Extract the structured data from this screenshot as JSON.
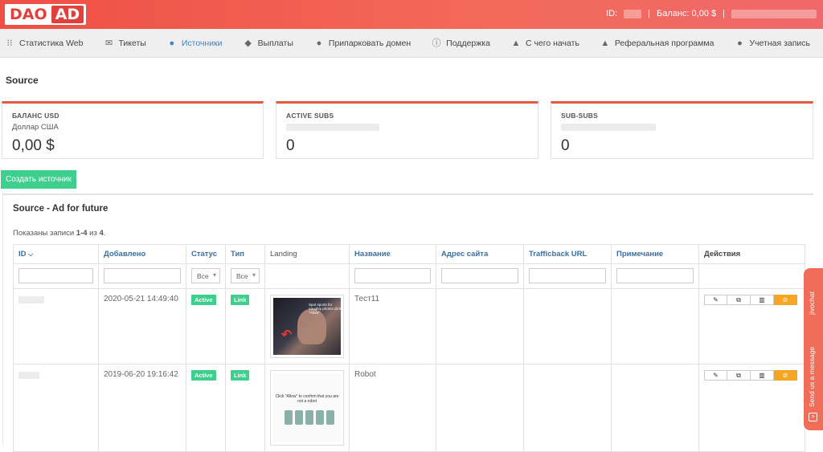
{
  "header": {
    "logo_left": "DAO",
    "logo_right": "AD",
    "id_label": "ID:",
    "balance": "Баланс: 0,00 $",
    "sep": "|"
  },
  "nav": {
    "items": [
      {
        "label": "Статистика Web",
        "icon": "grid-icon"
      },
      {
        "label": "Тикеты",
        "icon": "envelope-icon"
      },
      {
        "label": "Источники",
        "icon": "globe-icon"
      },
      {
        "label": "Выплаты",
        "icon": "piggy-bank-icon"
      },
      {
        "label": "Припарковать домен",
        "icon": "globe-icon"
      },
      {
        "label": "Поддержка",
        "icon": "info-icon"
      },
      {
        "label": "С чего начать",
        "icon": "road-icon"
      },
      {
        "label": "Реферальная программа",
        "icon": "road-icon"
      },
      {
        "label": "Учетная запись",
        "icon": "user-icon"
      }
    ]
  },
  "page": {
    "title": "Source"
  },
  "cards": [
    {
      "label": "БАЛАНС USD",
      "sub": "Доллар США",
      "value": "0,00 $"
    },
    {
      "label": "ACTIVE SUBS",
      "value": "0"
    },
    {
      "label": "SUB-SUBS",
      "value": "0"
    }
  ],
  "create_button": "Создать источник",
  "panel": {
    "title": "Source - Ad for future",
    "records_prefix": "Показаны записи ",
    "records_range": "1-4",
    "records_mid": " из ",
    "records_total": "4",
    "records_suffix": "."
  },
  "table": {
    "headers": {
      "id": "ID",
      "added": "Добавлено",
      "status": "Статус",
      "type": "Тип",
      "landing": "Landing",
      "name": "Название",
      "site": "Адрес сайта",
      "traffic": "Trafficback URL",
      "note": "Примечание",
      "actions": "Действия"
    },
    "filter_all": "Все",
    "rows": [
      {
        "added": "2020-05-21 14:49:40",
        "status": "Active",
        "type": "Link",
        "name": "Тест11",
        "landing_caption": "Spot sports\nfor naughty photos\nclick \"Allow\""
      },
      {
        "added": "2019-06-20 19:16:42",
        "status": "Active",
        "type": "Link",
        "name": "Robot",
        "landing_caption": "Click \"Allow\"\nto confirm that you are not a robot"
      }
    ],
    "action_icons": [
      "pencil-icon",
      "copy-icon",
      "stats-icon",
      "link-icon"
    ]
  },
  "chat": {
    "brand": "jivochat",
    "cta": "Send us a message"
  }
}
